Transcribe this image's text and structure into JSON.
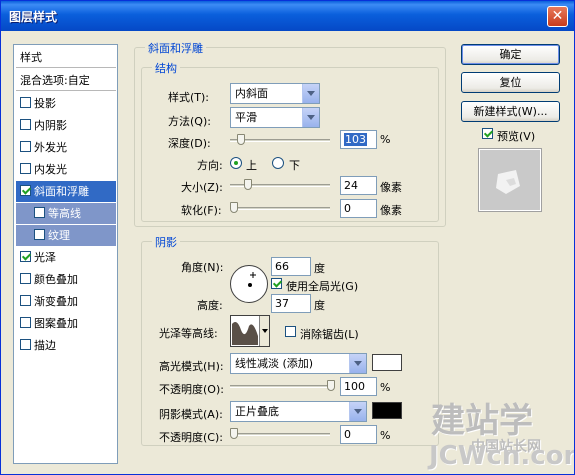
{
  "title": "图层样式",
  "close_glyph": "✕",
  "panel": {
    "items": [
      {
        "label": "样式",
        "type": "header"
      },
      {
        "label": "混合选项:自定",
        "type": "header"
      },
      {
        "label": "投影",
        "checked": false
      },
      {
        "label": "内阴影",
        "checked": false
      },
      {
        "label": "外发光",
        "checked": false
      },
      {
        "label": "内发光",
        "checked": false
      },
      {
        "label": "斜面和浮雕",
        "checked": true,
        "selected": true
      },
      {
        "label": "等高线",
        "checked": false,
        "sub": true
      },
      {
        "label": "纹理",
        "checked": false,
        "sub": true
      },
      {
        "label": "光泽",
        "checked": true
      },
      {
        "label": "颜色叠加",
        "checked": false
      },
      {
        "label": "渐变叠加",
        "checked": false
      },
      {
        "label": "图案叠加",
        "checked": false
      },
      {
        "label": "描边",
        "checked": false
      }
    ]
  },
  "bevel": {
    "section_title": "斜面和浮雕",
    "structure_title": "结构",
    "style_label": "样式(T):",
    "style_value": "内斜面",
    "method_label": "方法(Q):",
    "method_value": "平滑",
    "depth_label": "深度(D):",
    "depth_value": "103",
    "depth_unit": "%",
    "depth_level_pct": 103,
    "direction_label": "方向:",
    "direction_up": "上",
    "direction_down": "下",
    "size_label": "大小(Z):",
    "size_value": "24",
    "size_unit": "像素",
    "soften_label": "软化(F):",
    "soften_value": "0",
    "soften_unit": "像素"
  },
  "shading": {
    "title": "阴影",
    "angle_label": "角度(N):",
    "angle_value": "66",
    "angle_unit": "度",
    "global_light_label": "使用全局光(G)",
    "altitude_label": "高度:",
    "altitude_value": "37",
    "altitude_unit": "度",
    "gloss_label": "光泽等高线:",
    "antialias_label": "消除锯齿(L)",
    "highlight_mode_label": "高光模式(H):",
    "highlight_mode_value": "线性减淡 (添加)",
    "highlight_color": "#ffffff",
    "highlight_opacity_label": "不透明度(O):",
    "highlight_opacity_value": "100",
    "opacity_unit": "%",
    "shadow_mode_label": "阴影模式(A):",
    "shadow_mode_value": "正片叠底",
    "shadow_color": "#000000",
    "shadow_opacity_label": "不透明度(C):",
    "shadow_opacity_value": "0"
  },
  "buttons": {
    "ok": "确定",
    "reset": "复位",
    "new_style": "新建样式(W)...",
    "preview": "预览(V)"
  },
  "watermark": {
    "line1": "建站学",
    "line2": "中国站长网",
    "line3": "JCWcn.com"
  }
}
